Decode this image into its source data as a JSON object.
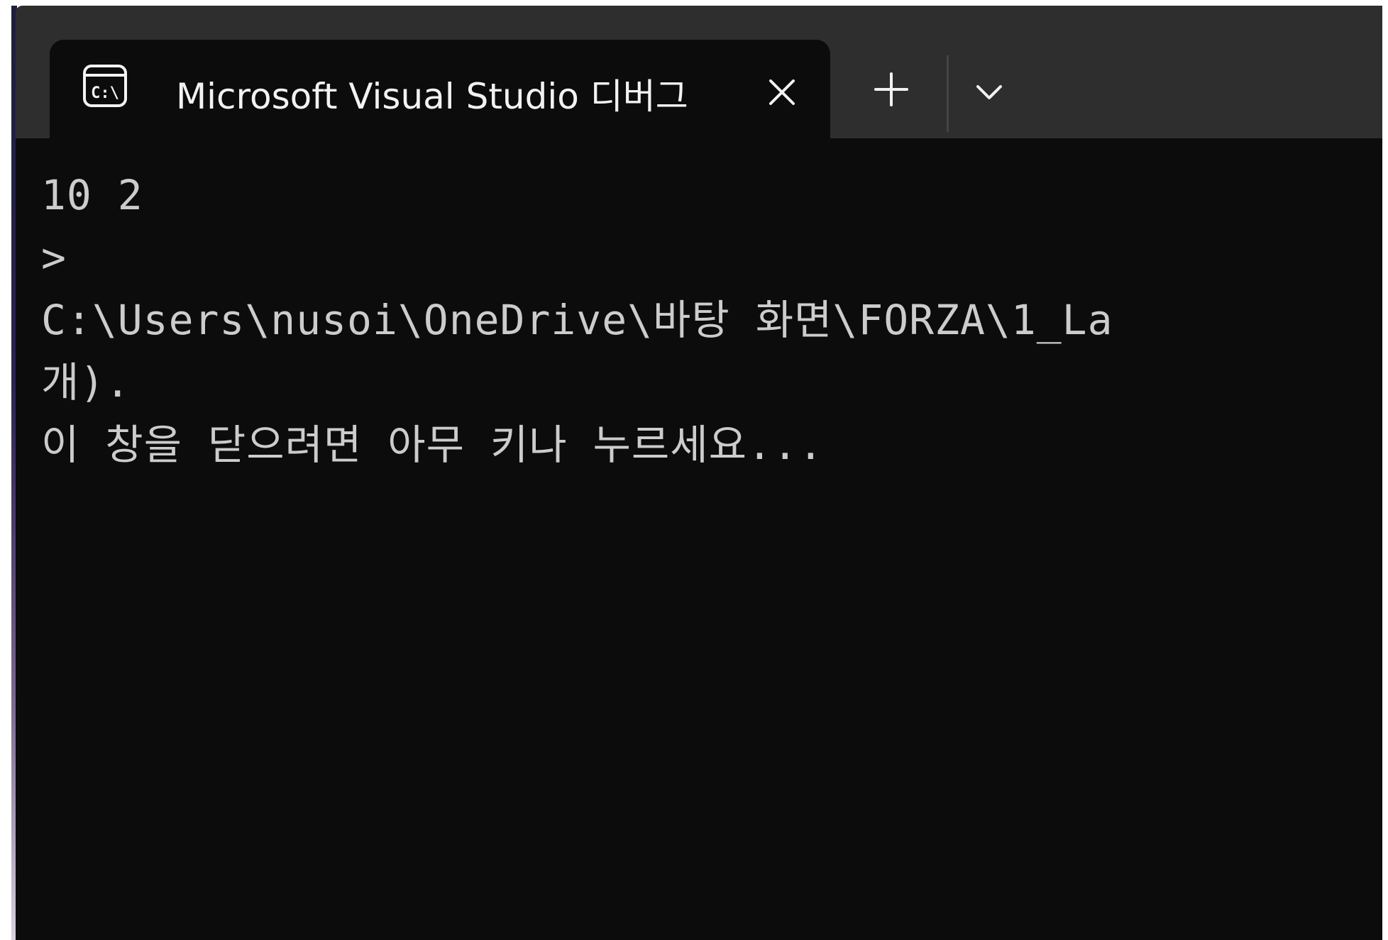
{
  "window": {
    "tab_title": "Microsoft Visual Studio 디버그",
    "tab_icon": "console-icon",
    "close_icon": "close-icon",
    "new_tab_icon": "plus-icon",
    "dropdown_icon": "chevron-down-icon"
  },
  "console": {
    "lines": [
      "10 2",
      ">",
      "C:\\Users\\nusoi\\OneDrive\\바탕 화면\\FORZA\\1_La",
      "개).",
      "이 창을 닫으려면 아무 키나 누르세요..."
    ]
  },
  "colors": {
    "titlebar": "#2e2e2e",
    "terminal_bg": "#0c0c0c",
    "terminal_text": "#cccccc",
    "tab_text": "#f2f2f2"
  }
}
